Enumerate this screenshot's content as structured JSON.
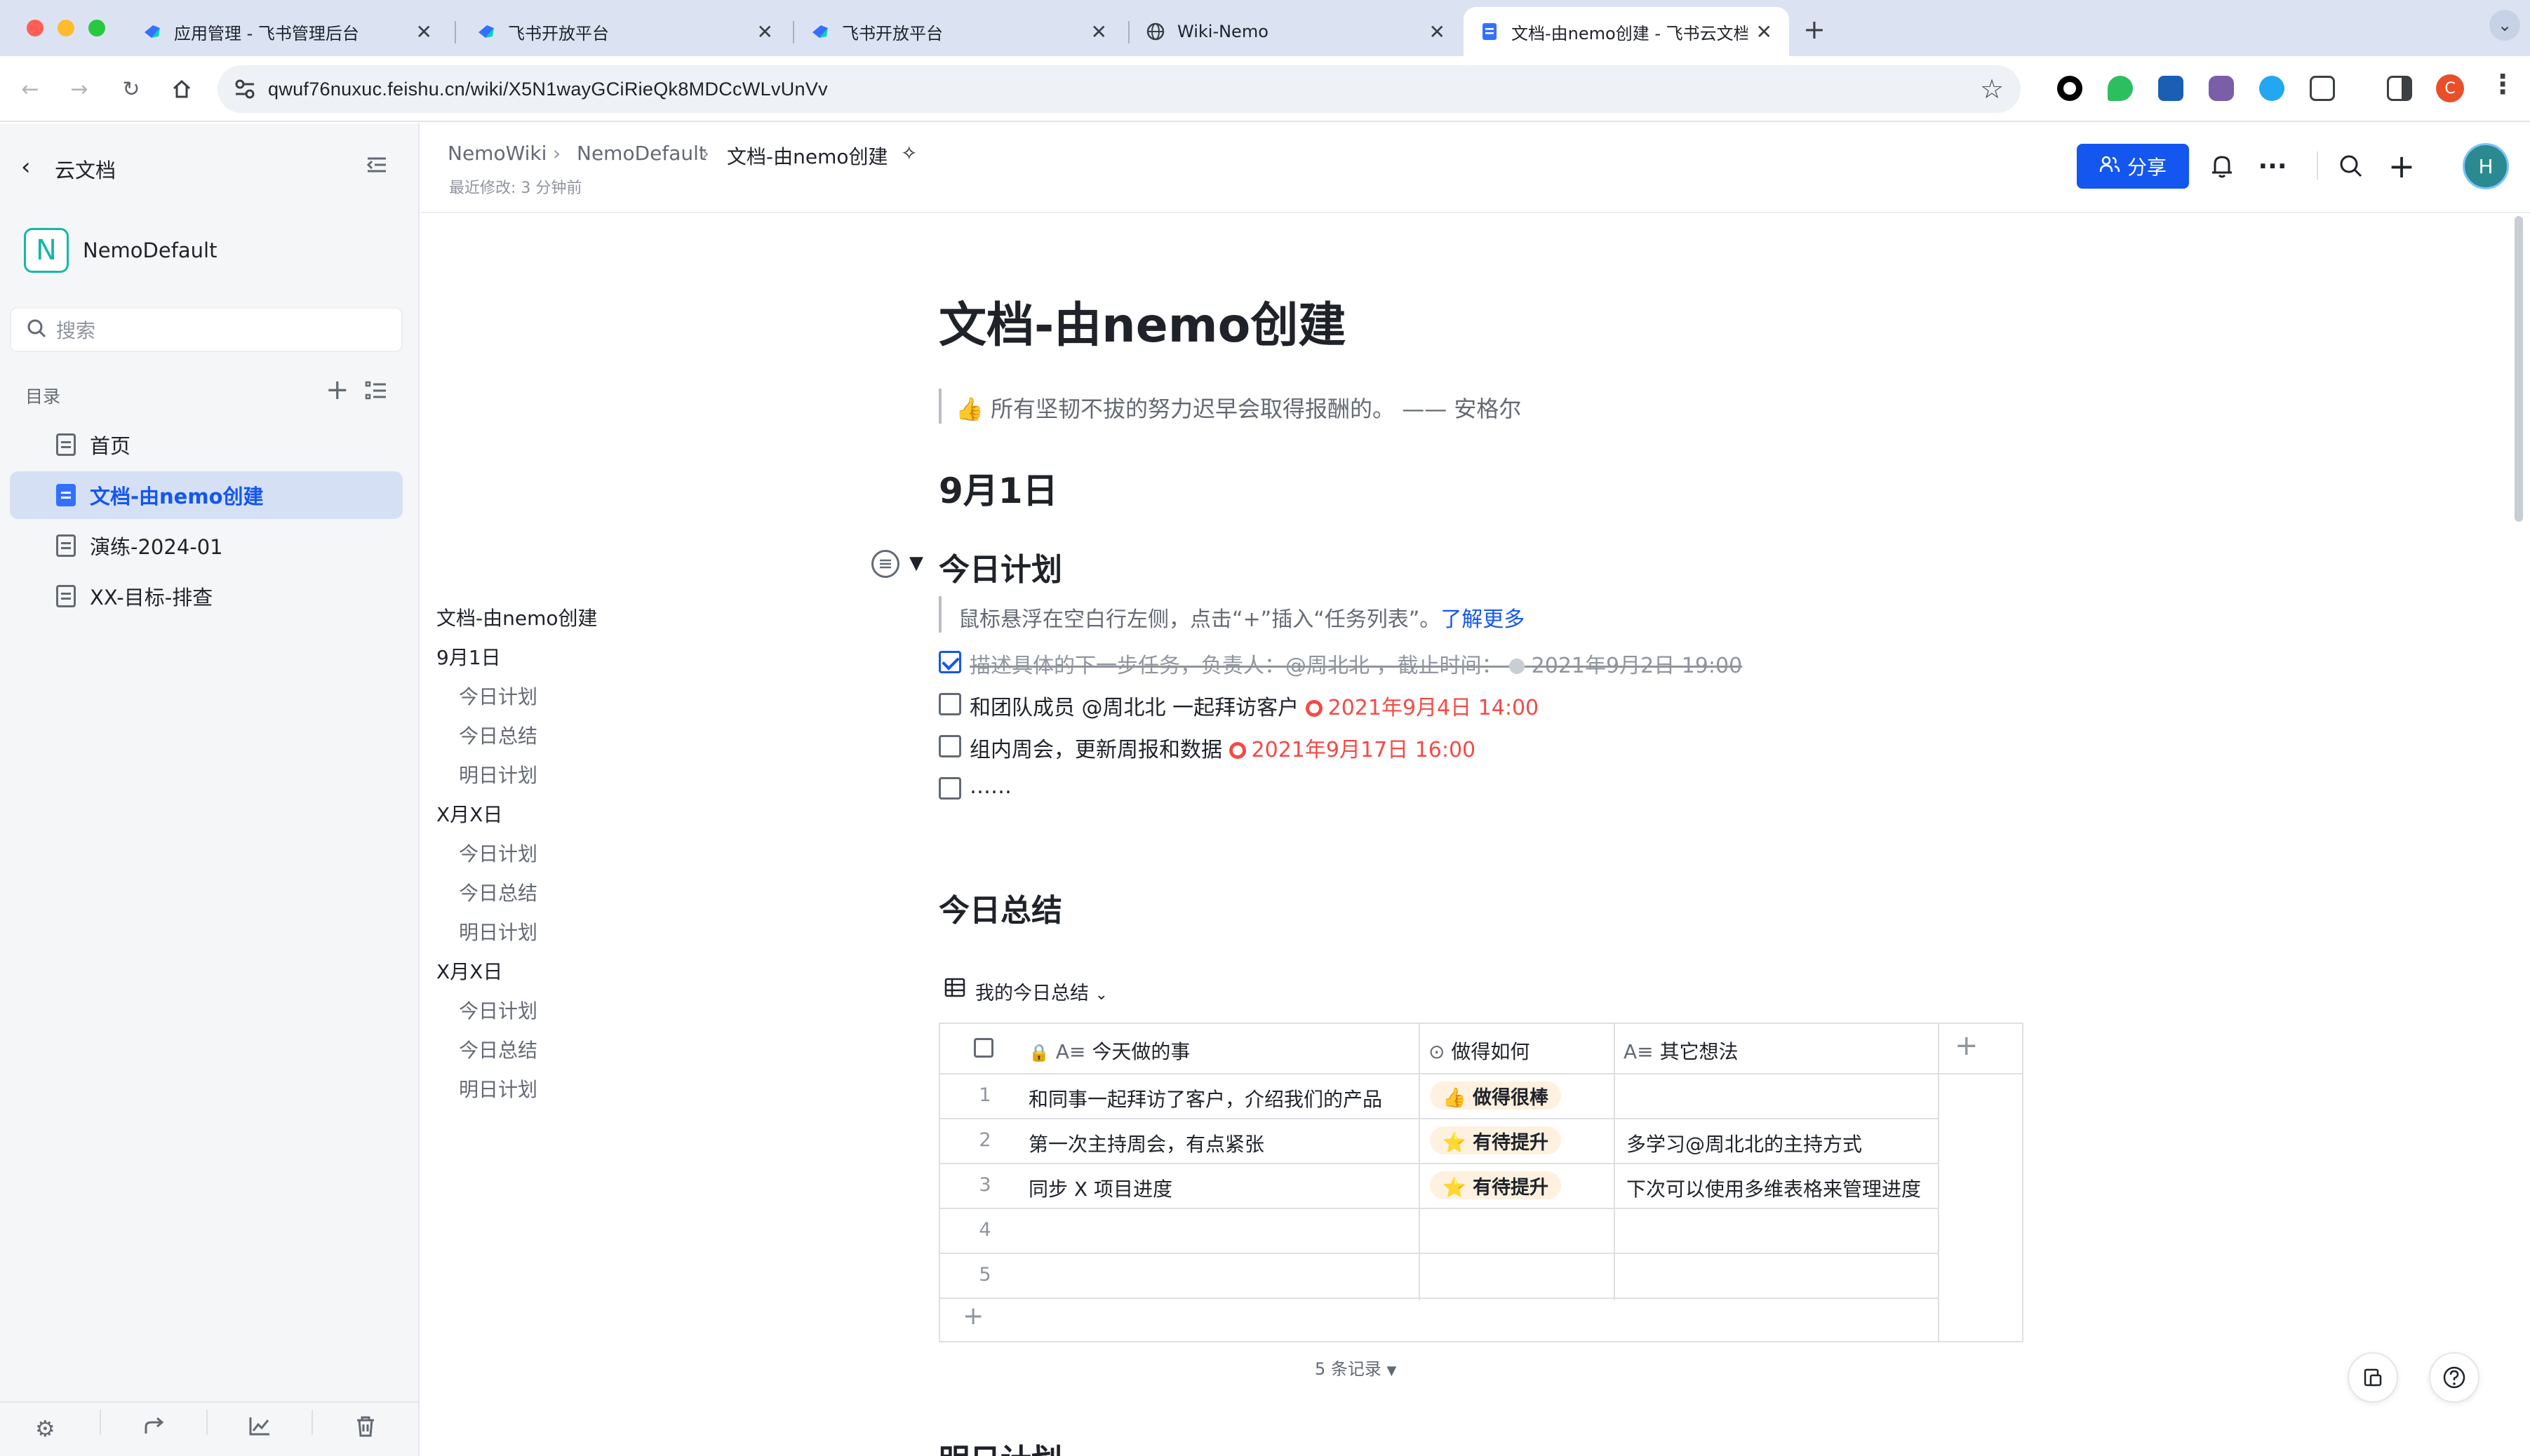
{
  "browser": {
    "tabs": [
      {
        "title": "应用管理 - 飞书管理后台"
      },
      {
        "title": "飞书开放平台"
      },
      {
        "title": "飞书开放平台"
      },
      {
        "title": "Wiki-Nemo"
      },
      {
        "title": "文档-由nemo创建 - 飞书云文档"
      }
    ],
    "url": "qwuf76nuxuc.feishu.cn/wiki/X5N1wayGCiRieQk8MDCcWLvUnVv",
    "profile_letter": "C"
  },
  "sidebar": {
    "back_label": "云文档",
    "space_letter": "N",
    "space_name": "NemoDefault",
    "search_placeholder": "搜索",
    "toc_label": "目录",
    "items": [
      {
        "label": "首页"
      },
      {
        "label": "文档-由nemo创建"
      },
      {
        "label": "演练-2024-01"
      },
      {
        "label": "XX-目标-排查"
      }
    ]
  },
  "header": {
    "breadcrumb": [
      "NemoWiki",
      "NemoDefault",
      "文档-由nemo创建"
    ],
    "last_modified": "最近修改: 3 分钟前",
    "share_label": "分享",
    "avatar_letter": "H"
  },
  "outline": [
    "文档-由nemo创建",
    "9月1日",
    "今日计划",
    "今日总结",
    "明日计划",
    "X月X日",
    "今日计划",
    "今日总结",
    "明日计划",
    "X月X日",
    "今日计划",
    "今日总结",
    "明日计划"
  ],
  "doc": {
    "title": "文档-由nemo创建",
    "quote": "👍 所有坚韧不拔的努力迟早会取得报酬的。 —— 安格尔",
    "date_heading": "9月1日",
    "plan_heading": "今日计划",
    "plan_hint": "鼠标悬浮在空白行左侧，点击“+”插入“任务列表”。",
    "plan_hint_link": "了解更多",
    "tasks": [
      {
        "text": "描述具体的下一步任务，负责人：@周北北 ，截止时间：",
        "due": "2021年9月2日 19:00",
        "done": true
      },
      {
        "text": "和团队成员 @周北北 一起拜访客户",
        "due": "2021年9月4日 14:00",
        "done": false
      },
      {
        "text": "组内周会，更新周报和数据",
        "due": "2021年9月17日 16:00",
        "done": false
      },
      {
        "text": "……",
        "due": "",
        "done": false
      }
    ],
    "summary_heading": "今日总结",
    "tomorrow_heading": "明日计划"
  },
  "table": {
    "view_name": "我的今日总结",
    "columns": [
      "今天做的事",
      "做得如何",
      "其它想法"
    ],
    "rows": [
      {
        "num": "1",
        "did": "和同事一起拜访了客户，介绍我们的产品",
        "how": "👍 做得很棒",
        "notes": ""
      },
      {
        "num": "2",
        "did": "第一次主持周会，有点紧张",
        "how": "⭐ 有待提升",
        "notes": "多学习@周北北的主持方式"
      },
      {
        "num": "3",
        "did": "同步 X 项目进度",
        "how": "⭐ 有待提升",
        "notes": "下次可以使用多维表格来管理进度"
      },
      {
        "num": "4",
        "did": "",
        "how": "",
        "notes": ""
      },
      {
        "num": "5",
        "did": "",
        "how": "",
        "notes": ""
      }
    ],
    "record_count": "5 条记录"
  },
  "colors": {
    "accent": "#1456f0",
    "due_red": "#f54a45",
    "sidebar_bg": "#f5f6f7",
    "active_item_bg": "#d6e0f5",
    "tab_bar_bg": "#dbe3f3"
  }
}
